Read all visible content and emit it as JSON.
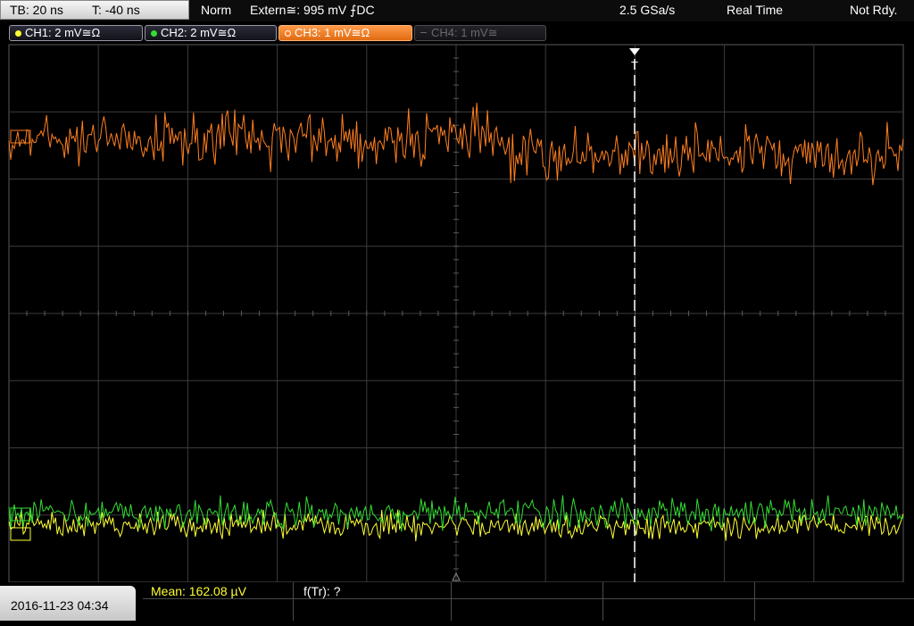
{
  "status": {
    "timebase": "TB: 20 ns",
    "trigger_time": "T: -40 ns",
    "trigger_mode": "Norm",
    "trigger_source": "Extern≅: 995 mV ⨍DC",
    "sample_rate": "2.5 GSa/s",
    "acq_mode": "Real Time",
    "run_state": "Not Rdy."
  },
  "channels": [
    {
      "label": "CH1: 2 mV≅Ω",
      "color": "#ffff33",
      "state": "on"
    },
    {
      "label": "CH2: 2 mV≅Ω",
      "color": "#33dd33",
      "state": "on"
    },
    {
      "label": "CH3: 1 mV≅Ω",
      "color": "#ff7f1f",
      "state": "selected"
    },
    {
      "label": "CH4: 1 mV≅",
      "color": "#666666",
      "state": "off"
    }
  ],
  "trigger_marker": "T",
  "timestamp": "2016-11-23 04:34",
  "measurements": {
    "mean": "Mean: 162.08 µV",
    "ftr": "f(Tr): ?"
  },
  "colors": {
    "ch1": "#ffff33",
    "ch2": "#33dd33",
    "ch3": "#ff7f1f",
    "grid": "#3c3c3c",
    "trigger": "#ffffff",
    "mean_text": "#ffff33"
  }
}
